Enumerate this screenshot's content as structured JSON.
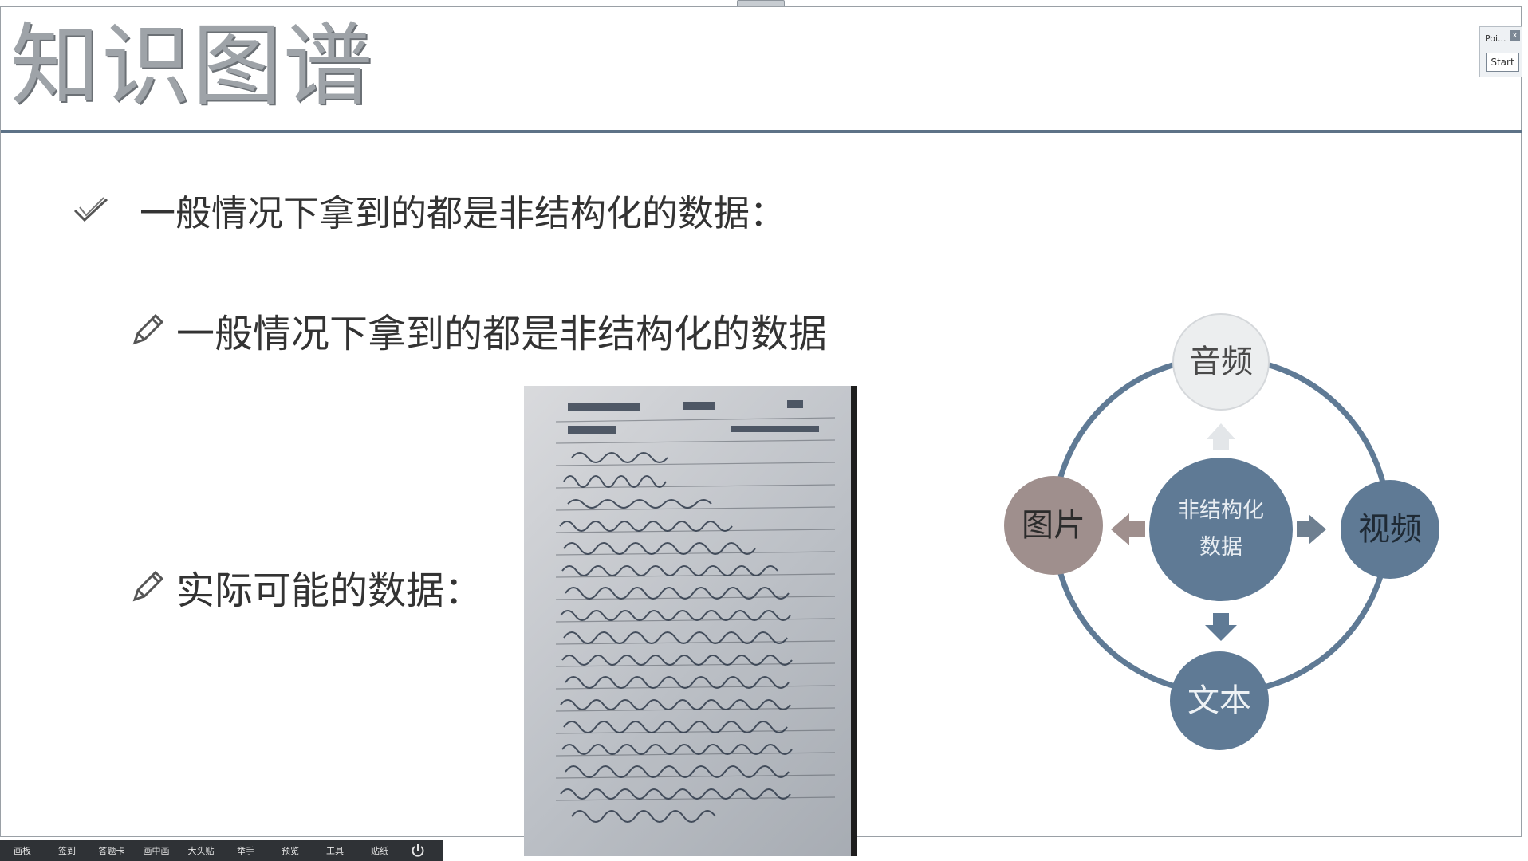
{
  "slide": {
    "title": "知识图谱",
    "bullets": [
      "一般情况下拿到的都是非结构化的数据：",
      "一般情况下拿到的都是非结构化的数据",
      "实际可能的数据："
    ]
  },
  "mini_panel": {
    "title": "Poi...",
    "close": "x",
    "start": "Start"
  },
  "diagram": {
    "center_line1": "非结构化",
    "center_line2": "数据",
    "nodes": [
      "音频",
      "视频",
      "文本",
      "图片"
    ]
  },
  "toolbar": {
    "items": [
      "画板",
      "签到",
      "答题卡",
      "画中画",
      "大头贴",
      "举手",
      "预览",
      "工具",
      "贴纸"
    ]
  },
  "colors": {
    "accent": "#5d7287",
    "node_blue": "#5f7a95",
    "node_photo": "#9f8f8d",
    "node_audio": "#eceeef",
    "toolbar": "#2f3236"
  }
}
